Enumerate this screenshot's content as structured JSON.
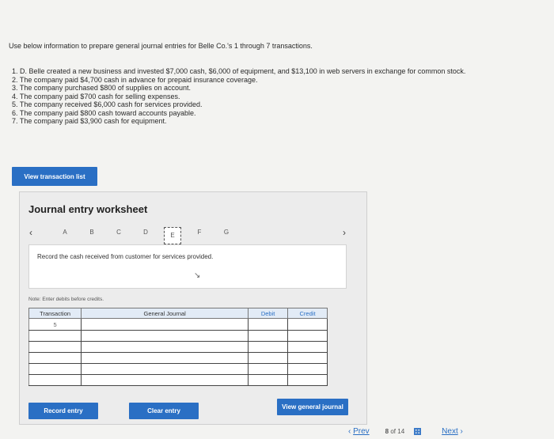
{
  "intro": "Use below information to prepare general journal entries for Belle Co.'s 1 through 7 transactions.",
  "transactions": [
    "1. D. Belle created a new business and invested $7,000 cash, $6,000 of equipment, and $13,100 in web servers in exchange for common stock.",
    "2. The company paid $4,700 cash in advance for prepaid insurance coverage.",
    "3. The company purchased $800 of supplies on account.",
    "4. The company paid $700 cash for selling expenses.",
    "5. The company received $6,000 cash for services provided.",
    "6. The company paid $800 cash toward accounts payable.",
    "7. The company paid $3,900 cash for equipment."
  ],
  "buttons": {
    "view_transaction_list": "View transaction list",
    "record_entry": "Record entry",
    "clear_entry": "Clear entry",
    "view_general_journal": "View general journal"
  },
  "worksheet": {
    "title": "Journal entry worksheet",
    "tabs": [
      "A",
      "B",
      "C",
      "D",
      "E",
      "F",
      "G"
    ],
    "active_tab": "E",
    "instruction": "Record the cash received from customer for services provided.",
    "note": "Note: Enter debits before credits."
  },
  "journal": {
    "headers": {
      "transaction": "Transaction",
      "general_journal": "General Journal",
      "debit": "Debit",
      "credit": "Credit"
    },
    "transaction_number": "5"
  },
  "footer": {
    "prev": "Prev",
    "page": "8",
    "of": "of 14",
    "next": "Next"
  },
  "colors": {
    "accent": "#2a6fc4",
    "background": "#f3f3f1"
  }
}
